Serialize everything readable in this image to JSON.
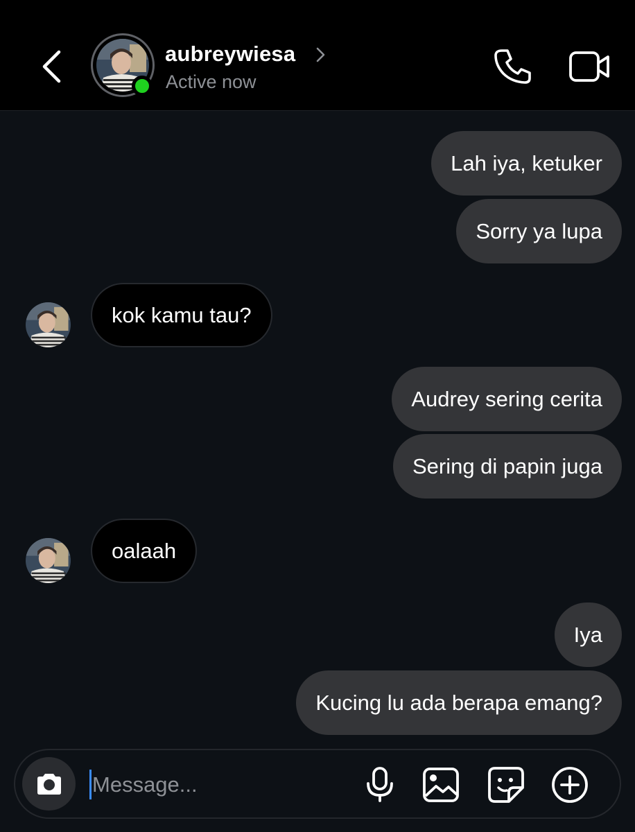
{
  "header": {
    "back_icon": "chevron-left-icon",
    "username": "aubreywiesa",
    "status": "Active now",
    "online_color": "#1fd11f",
    "call_icon": "phone-icon",
    "video_icon": "video-camera-icon"
  },
  "messages": [
    {
      "direction": "sent",
      "text": "Lah iya, ketuker"
    },
    {
      "direction": "sent",
      "text": "Sorry ya lupa"
    },
    {
      "direction": "received",
      "text": "kok kamu tau?"
    },
    {
      "direction": "sent",
      "text": "Audrey sering cerita"
    },
    {
      "direction": "sent",
      "text": "Sering di papin juga"
    },
    {
      "direction": "received",
      "text": "oalaah"
    },
    {
      "direction": "sent",
      "text": "Iya"
    },
    {
      "direction": "sent",
      "text": "Kucing lu ada berapa emang?"
    }
  ],
  "composer": {
    "placeholder": "Message...",
    "camera_icon": "camera-icon",
    "mic_icon": "microphone-icon",
    "gallery_icon": "image-icon",
    "sticker_icon": "sticker-icon",
    "plus_icon": "plus-circle-icon"
  },
  "colors": {
    "background": "#0d1116",
    "header_bg": "#000000",
    "sent_bubble": "#343538",
    "received_bubble": "#000000",
    "muted_text": "#8e9196",
    "caret": "#3a8cff"
  }
}
